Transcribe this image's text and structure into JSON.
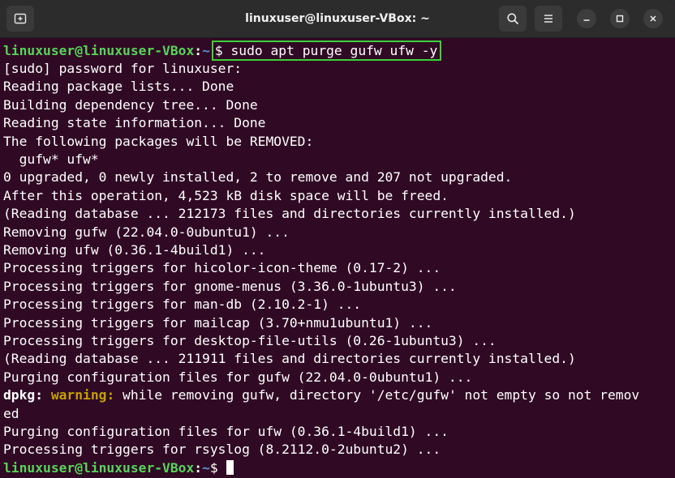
{
  "window": {
    "title": "linuxuser@linuxuser-VBox: ~"
  },
  "icons": {
    "new_tab": "new-tab-icon",
    "search": "search-icon",
    "menu": "hamburger-menu-icon",
    "minimize": "minimize-icon",
    "maximize": "maximize-icon",
    "close": "close-icon"
  },
  "colors": {
    "terminal_bg": "#300a24",
    "titlebar_bg": "#2c2c2c",
    "prompt_user": "#58d35a",
    "prompt_path": "#5f8fd9",
    "highlight_box": "#3bd13b",
    "warning": "#c4a000"
  },
  "terminal": {
    "prompt1": {
      "user_host": "linuxuser@linuxuser-VBox",
      "colon": ":",
      "path": "~",
      "command": "$ sudo apt purge gufw ufw -y"
    },
    "output": [
      "[sudo] password for linuxuser:",
      "Reading package lists... Done",
      "Building dependency tree... Done",
      "Reading state information... Done",
      "The following packages will be REMOVED:",
      "  gufw* ufw*",
      "0 upgraded, 0 newly installed, 2 to remove and 207 not upgraded.",
      "After this operation, 4,523 kB disk space will be freed.",
      "(Reading database ... 212173 files and directories currently installed.)",
      "Removing gufw (22.04.0-0ubuntu1) ...",
      "Removing ufw (0.36.1-4build1) ...",
      "Processing triggers for hicolor-icon-theme (0.17-2) ...",
      "Processing triggers for gnome-menus (3.36.0-1ubuntu3) ...",
      "Processing triggers for man-db (2.10.2-1) ...",
      "Processing triggers for mailcap (3.70+nmu1ubuntu1) ...",
      "Processing triggers for desktop-file-utils (0.26-1ubuntu3) ...",
      "(Reading database ... 211911 files and directories currently installed.)",
      "Purging configuration files for gufw (22.04.0-0ubuntu1) ..."
    ],
    "warning_line": {
      "prefix": "dpkg:",
      "label": "warning:",
      "message": " while removing gufw, directory '/etc/gufw' not empty so not remov",
      "continuation": "ed"
    },
    "output2": [
      "Purging configuration files for ufw (0.36.1-4build1) ...",
      "Processing triggers for rsyslog (8.2112.0-2ubuntu2) ..."
    ],
    "prompt2": {
      "user_host": "linuxuser@linuxuser-VBox",
      "colon": ":",
      "path": "~",
      "symbol": "$ "
    }
  }
}
